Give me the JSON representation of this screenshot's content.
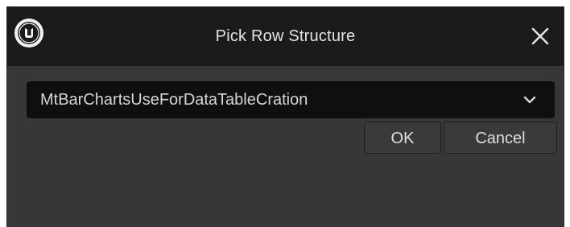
{
  "window": {
    "title": "Pick Row Structure",
    "logo_icon": "unreal-engine-logo-icon",
    "close_icon": "close-icon"
  },
  "row_structure_select": {
    "selected_value": "MtBarChartsUseForDataTableCration",
    "chevron_icon": "chevron-down-icon"
  },
  "actions": {
    "ok_label": "OK",
    "cancel_label": "Cancel"
  },
  "colors": {
    "titlebar_bg": "#1b1b1b",
    "dialog_bg": "#373737",
    "combo_bg": "#0f0f0f",
    "text": "#e4e4e4"
  }
}
